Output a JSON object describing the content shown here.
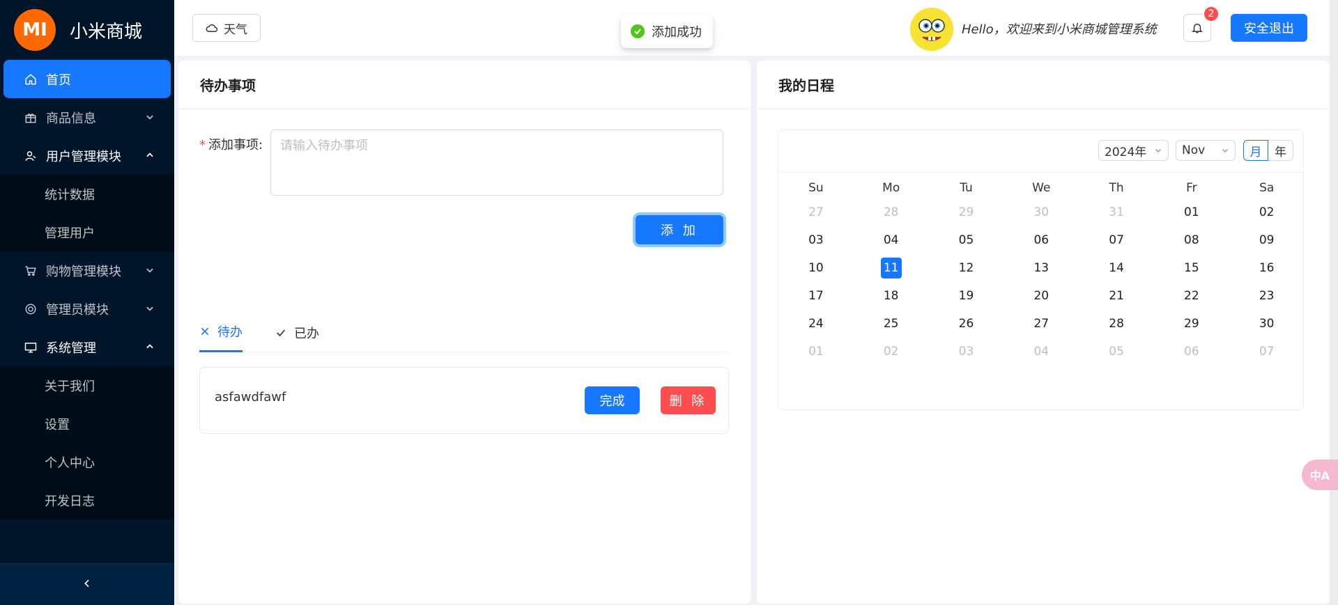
{
  "sidebar": {
    "logo_mark": "MI",
    "logo_text": "小米商城",
    "items": [
      {
        "label": "首页"
      },
      {
        "label": "商品信息"
      },
      {
        "label": "用户管理模块"
      },
      {
        "label": "统计数据"
      },
      {
        "label": "管理用户"
      },
      {
        "label": "购物管理模块"
      },
      {
        "label": "管理员模块"
      },
      {
        "label": "系统管理"
      },
      {
        "label": "关于我们"
      },
      {
        "label": "设置"
      },
      {
        "label": "个人中心"
      },
      {
        "label": "开发日志"
      }
    ]
  },
  "header": {
    "weather_label": "天气",
    "welcome": "Hello，欢迎来到小米商城管理系统",
    "notification_count": "2",
    "logout_label": "安全退出"
  },
  "toast": {
    "message": "添加成功"
  },
  "todo": {
    "title": "待办事项",
    "field_label": "添加事项:",
    "placeholder": "请输入待办事项",
    "add_label": "添 加",
    "tabs": [
      {
        "label": "待办"
      },
      {
        "label": "已办"
      }
    ],
    "items": [
      {
        "text": "asfawdfawf",
        "done_label": "完成",
        "delete_label": "删 除"
      }
    ]
  },
  "schedule": {
    "title": "我的日程",
    "year_select": "2024年",
    "month_select": "Nov",
    "mode_month": "月",
    "mode_year": "年",
    "weekdays": [
      "Su",
      "Mo",
      "Tu",
      "We",
      "Th",
      "Fr",
      "Sa"
    ],
    "selected_day": "11",
    "weeks": [
      [
        "27",
        "28",
        "29",
        "30",
        "31",
        "01",
        "02"
      ],
      [
        "03",
        "04",
        "05",
        "06",
        "07",
        "08",
        "09"
      ],
      [
        "10",
        "11",
        "12",
        "13",
        "14",
        "15",
        "16"
      ],
      [
        "17",
        "18",
        "19",
        "20",
        "21",
        "22",
        "23"
      ],
      [
        "24",
        "25",
        "26",
        "27",
        "28",
        "29",
        "30"
      ],
      [
        "01",
        "02",
        "03",
        "04",
        "05",
        "06",
        "07"
      ]
    ],
    "dim_mask": [
      [
        true,
        true,
        true,
        true,
        true,
        false,
        false
      ],
      [
        false,
        false,
        false,
        false,
        false,
        false,
        false
      ],
      [
        false,
        false,
        false,
        false,
        false,
        false,
        false
      ],
      [
        false,
        false,
        false,
        false,
        false,
        false,
        false
      ],
      [
        false,
        false,
        false,
        false,
        false,
        false,
        false
      ],
      [
        true,
        true,
        true,
        true,
        true,
        true,
        true
      ]
    ]
  },
  "float_widget": {
    "label": "中A"
  },
  "colors": {
    "primary": "#1677ff",
    "danger": "#ff4d4f",
    "sidebar_bg": "#001529",
    "brand_orange": "#ff6900",
    "success": "#52c41a"
  }
}
